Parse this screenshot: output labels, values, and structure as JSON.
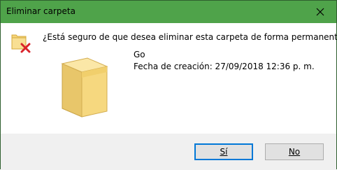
{
  "window": {
    "title": "Eliminar carpeta"
  },
  "dialog": {
    "question": "¿Está seguro de que desea eliminar esta carpeta de forma permanente?",
    "item_name": "Go",
    "created_label": "Fecha de creación: 27/09/2018 12:36 p. m."
  },
  "buttons": {
    "yes_label": "Sí",
    "no_label": "No"
  },
  "icons": {
    "close": "close-icon",
    "small_folder": "folder-delete-icon",
    "big_folder": "folder-icon"
  },
  "colors": {
    "titlebar": "#4fa34a",
    "footer": "#f0f0f0",
    "button_focus_border": "#0078d7",
    "delete_x": "#d9232a"
  }
}
